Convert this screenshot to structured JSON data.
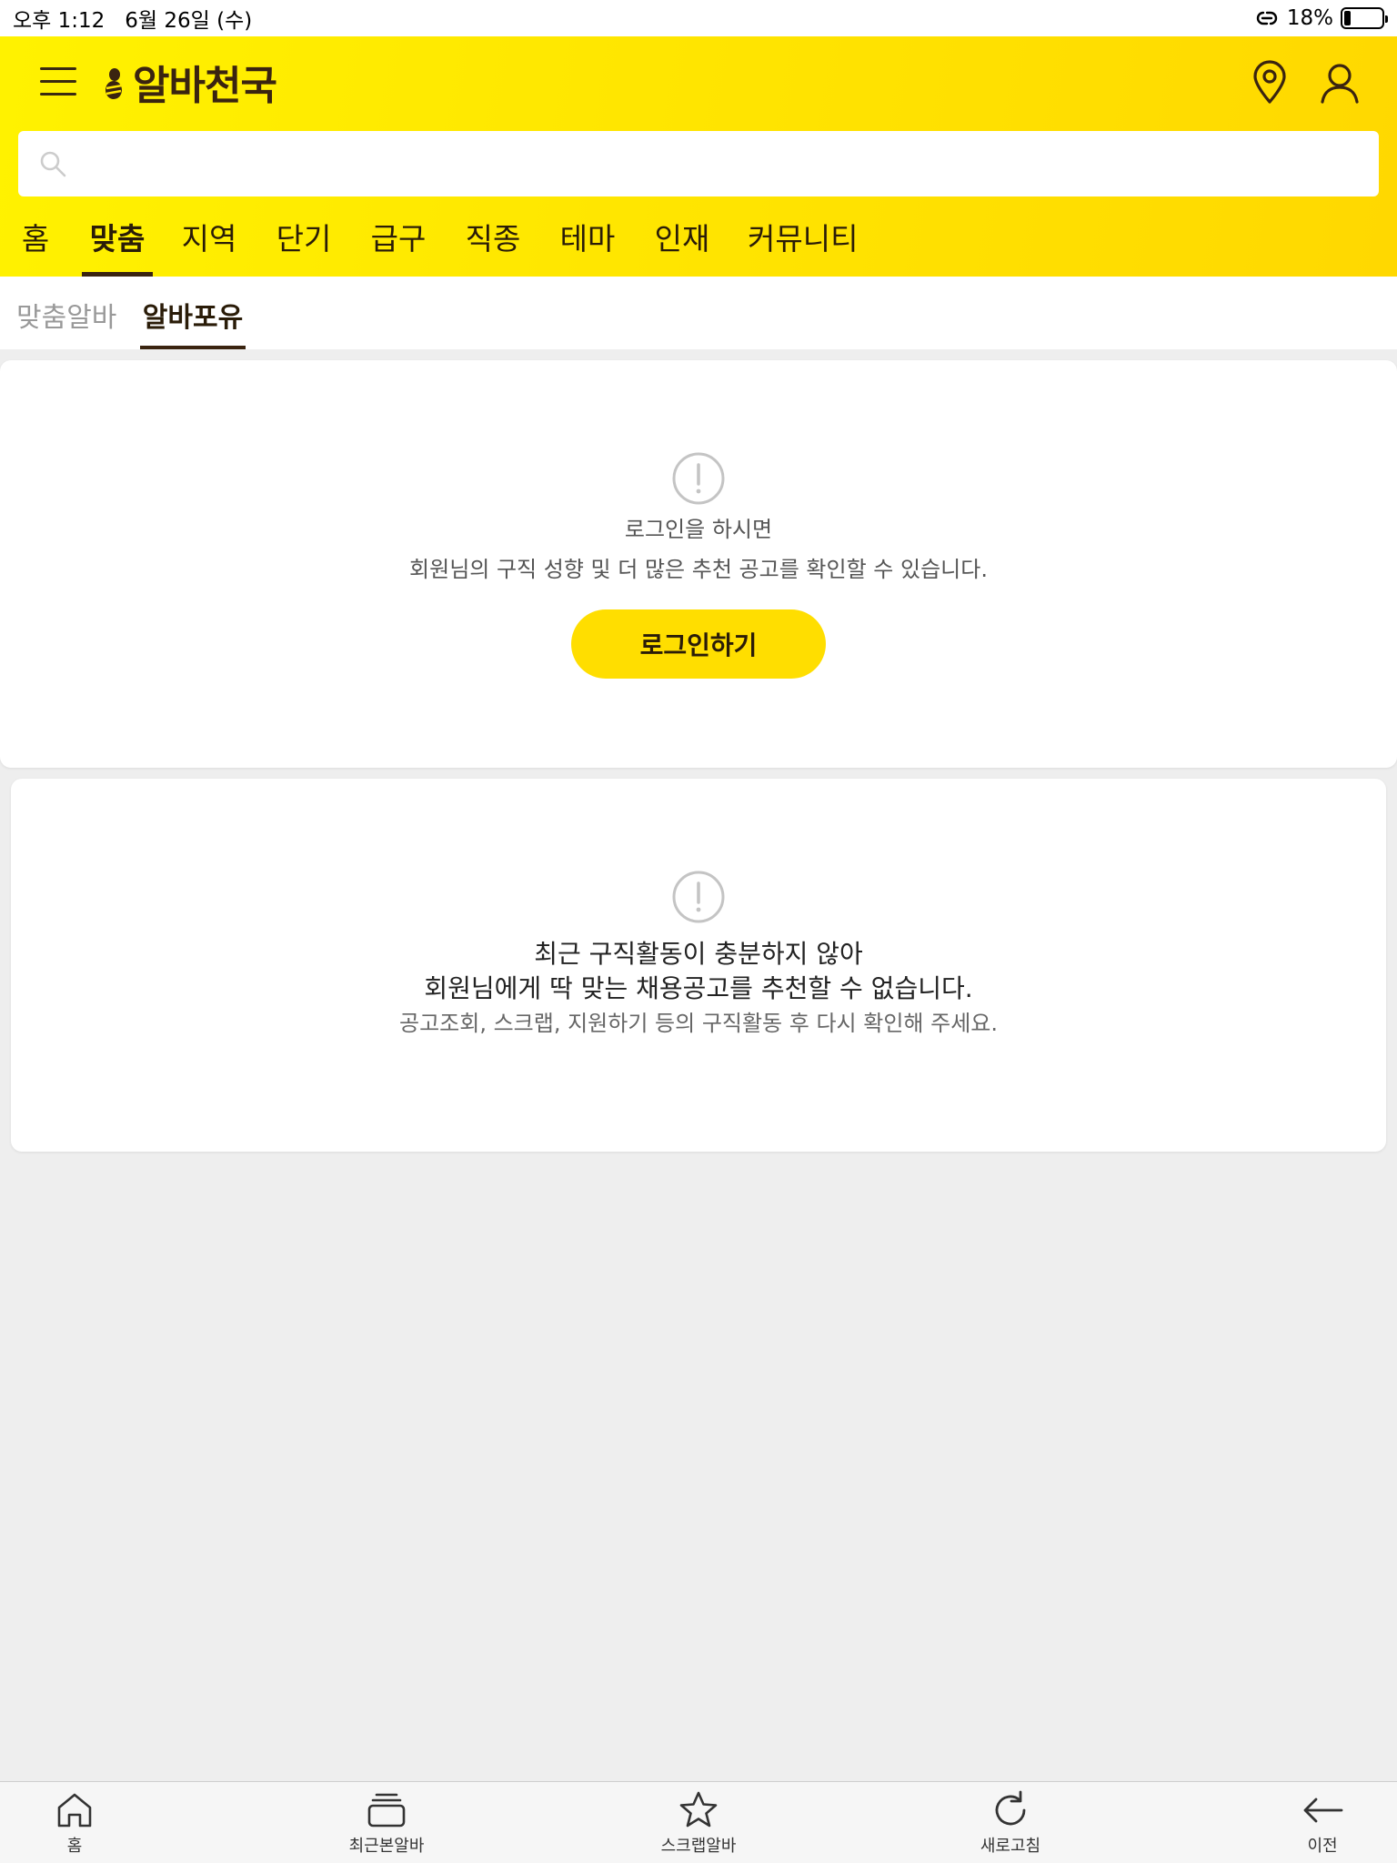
{
  "status_bar": {
    "time": "오후 1:12",
    "date": "6월 26일 (수)",
    "battery_text": "18%",
    "battery_level": 0.18
  },
  "header": {
    "logo_text": "알바천국",
    "search_placeholder": "",
    "tabs": [
      {
        "label": "홈",
        "active": false
      },
      {
        "label": "맞춤",
        "active": true
      },
      {
        "label": "지역",
        "active": false
      },
      {
        "label": "단기",
        "active": false
      },
      {
        "label": "급구",
        "active": false
      },
      {
        "label": "직종",
        "active": false
      },
      {
        "label": "테마",
        "active": false
      },
      {
        "label": "인재",
        "active": false
      },
      {
        "label": "커뮤니티",
        "active": false
      }
    ]
  },
  "subtabs": [
    {
      "label": "맞춤알바",
      "active": false
    },
    {
      "label": "알바포유",
      "active": true
    }
  ],
  "login_card": {
    "line1": "로그인을 하시면",
    "line2": "회원님의 구직 성향 및 더 많은 추천 공고를 확인할 수 있습니다.",
    "button_label": "로그인하기"
  },
  "activity_card": {
    "line1": "최근 구직활동이 충분하지 않아",
    "line2": "회원님에게 딱 맞는 채용공고를 추천할 수 없습니다.",
    "line3": "공고조회, 스크랩, 지원하기 등의 구직활동 후 다시 확인해 주세요."
  },
  "bottom_nav": {
    "home": "홈",
    "recent": "최근본알바",
    "scrap": "스크랩알바",
    "refresh": "새로고침",
    "back": "이전"
  },
  "colors": {
    "brand_yellow": "#ffde00",
    "brand_brown": "#3a2410"
  }
}
